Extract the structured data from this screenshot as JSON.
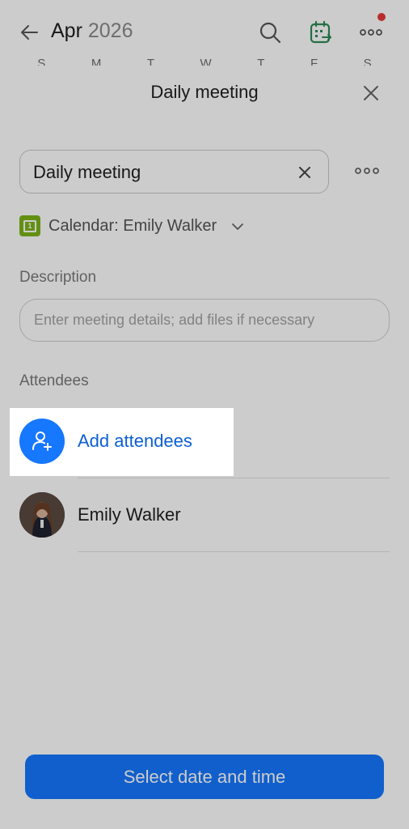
{
  "header": {
    "month": "Apr",
    "year": "2026",
    "weekdays": [
      "S",
      "M",
      "T",
      "W",
      "T",
      "F",
      "S"
    ]
  },
  "sheet": {
    "title": "Daily meeting",
    "meeting_name": "Daily meeting",
    "calendar_label": "Calendar: Emily Walker",
    "calendar_icon_day": "1",
    "description_label": "Description",
    "description_placeholder": "Enter meeting details; add files if necessary",
    "attendees_label": "Attendees",
    "add_attendees_label": "Add attendees",
    "attendees": [
      {
        "name": "Emily Walker"
      }
    ],
    "primary_button": "Select date and time"
  },
  "colors": {
    "accent": "#1677ff",
    "link": "#0d5fd3",
    "calendar_green": "#7cb518",
    "notification_dot": "#e53935"
  },
  "icons": {
    "back": "arrow-left-icon",
    "search": "search-icon",
    "calendar_swap": "calendar-swap-icon",
    "more": "more-horizontal-icon",
    "close": "close-icon",
    "clear": "clear-icon",
    "options": "more-horizontal-icon",
    "chevron": "chevron-down-icon",
    "add_person": "add-person-icon"
  }
}
